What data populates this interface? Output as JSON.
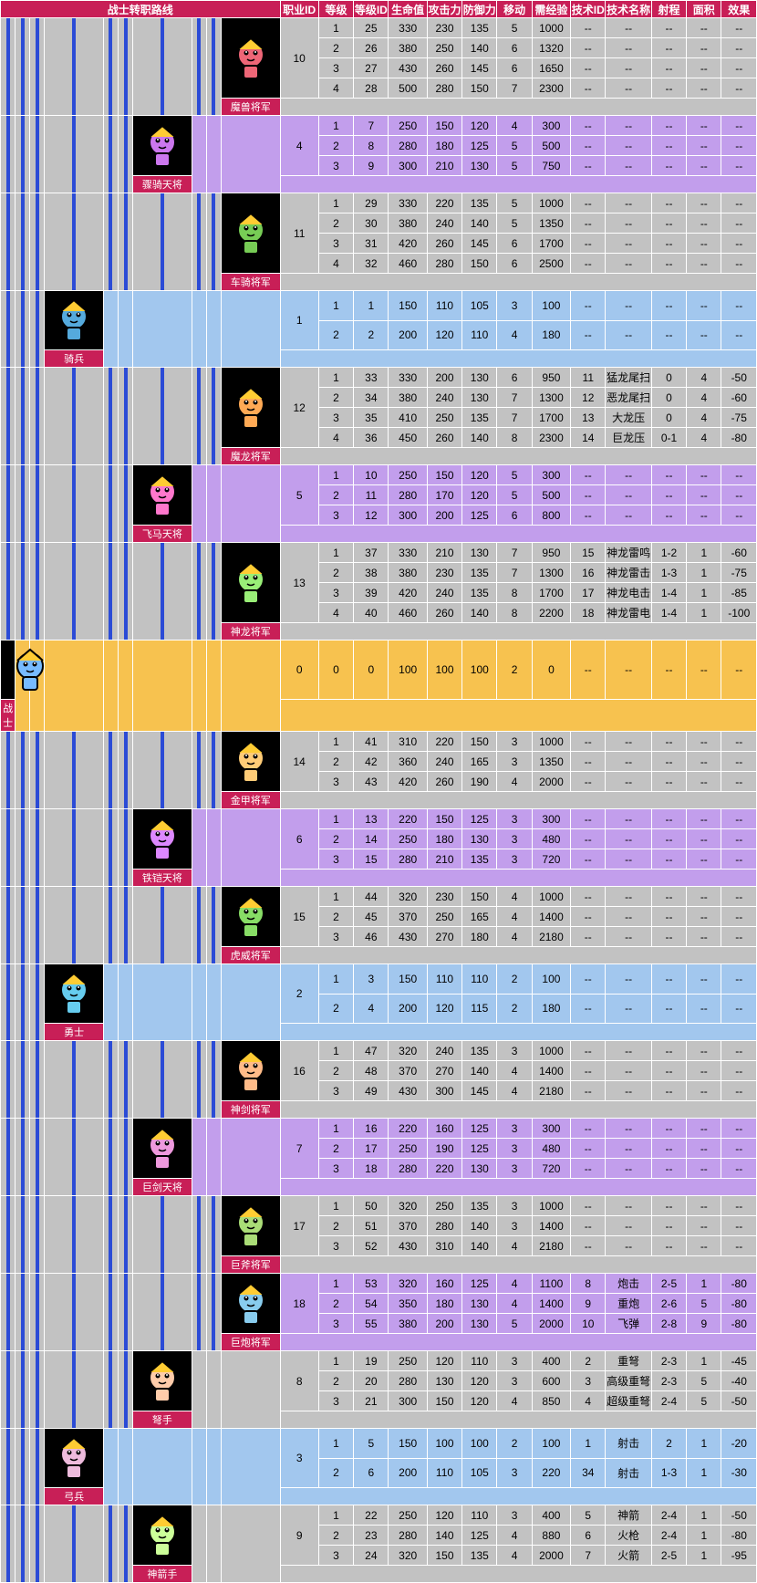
{
  "headers": {
    "tree": "战士转职路线",
    "jobid": "职业ID",
    "lvl": "等级",
    "lvlid": "等级ID",
    "hp": "生命值",
    "atk": "攻击力",
    "def": "防御力",
    "mov": "移动",
    "exp": "需经验",
    "skillid": "技术ID",
    "skillname": "技术名称",
    "range": "射程",
    "area": "面积",
    "effect": "效果"
  },
  "na": "--",
  "chart_data": {
    "type": "table",
    "title": "战士转职路线",
    "root": {
      "name": "战士",
      "jobid": 0,
      "color": "gold",
      "rows": [
        [
          0,
          0,
          100,
          100,
          100,
          2,
          0,
          "--",
          "--",
          "--",
          "--",
          "--"
        ]
      ]
    },
    "tier2": [
      {
        "name": "骑兵",
        "jobid": 1,
        "color": "blue",
        "rows": [
          [
            1,
            1,
            150,
            110,
            105,
            3,
            100,
            "--",
            "--",
            "--",
            "--",
            "--"
          ],
          [
            2,
            2,
            200,
            120,
            110,
            4,
            180,
            "--",
            "--",
            "--",
            "--",
            "--"
          ]
        ]
      },
      {
        "name": "勇士",
        "jobid": 2,
        "color": "blue",
        "rows": [
          [
            1,
            3,
            150,
            110,
            110,
            2,
            100,
            "--",
            "--",
            "--",
            "--",
            "--"
          ],
          [
            2,
            4,
            200,
            120,
            115,
            2,
            180,
            "--",
            "--",
            "--",
            "--",
            "--"
          ]
        ]
      },
      {
        "name": "弓兵",
        "jobid": 3,
        "color": "blue",
        "rows": [
          [
            1,
            5,
            150,
            100,
            100,
            2,
            100,
            1,
            "射击",
            "2",
            1,
            -20
          ],
          [
            2,
            6,
            200,
            110,
            105,
            3,
            220,
            34,
            "射击",
            "1-3",
            1,
            -30
          ]
        ]
      }
    ],
    "tier3": [
      {
        "parent": "骑兵",
        "name": "骤骑天将",
        "jobid": 4,
        "color": "purple",
        "rows": [
          [
            1,
            7,
            250,
            150,
            120,
            4,
            300,
            "--",
            "--",
            "--",
            "--",
            "--"
          ],
          [
            2,
            8,
            280,
            180,
            125,
            5,
            500,
            "--",
            "--",
            "--",
            "--",
            "--"
          ],
          [
            3,
            9,
            300,
            210,
            130,
            5,
            750,
            "--",
            "--",
            "--",
            "--",
            "--"
          ]
        ]
      },
      {
        "parent": "骑兵",
        "name": "飞马天将",
        "jobid": 5,
        "color": "purple",
        "rows": [
          [
            1,
            10,
            250,
            150,
            120,
            5,
            300,
            "--",
            "--",
            "--",
            "--",
            "--"
          ],
          [
            2,
            11,
            280,
            170,
            120,
            5,
            500,
            "--",
            "--",
            "--",
            "--",
            "--"
          ],
          [
            3,
            12,
            300,
            200,
            125,
            6,
            800,
            "--",
            "--",
            "--",
            "--",
            "--"
          ]
        ]
      },
      {
        "parent": "勇士",
        "name": "铁铠天将",
        "jobid": 6,
        "color": "purple",
        "rows": [
          [
            1,
            13,
            220,
            150,
            125,
            3,
            300,
            "--",
            "--",
            "--",
            "--",
            "--"
          ],
          [
            2,
            14,
            250,
            180,
            130,
            3,
            480,
            "--",
            "--",
            "--",
            "--",
            "--"
          ],
          [
            3,
            15,
            280,
            210,
            135,
            3,
            720,
            "--",
            "--",
            "--",
            "--",
            "--"
          ]
        ]
      },
      {
        "parent": "勇士",
        "name": "巨剑天将",
        "jobid": 7,
        "color": "purple",
        "rows": [
          [
            1,
            16,
            220,
            160,
            125,
            3,
            300,
            "--",
            "--",
            "--",
            "--",
            "--"
          ],
          [
            2,
            17,
            250,
            190,
            125,
            3,
            480,
            "--",
            "--",
            "--",
            "--",
            "--"
          ],
          [
            3,
            18,
            280,
            220,
            130,
            3,
            720,
            "--",
            "--",
            "--",
            "--",
            "--"
          ]
        ]
      },
      {
        "parent": "弓兵",
        "name": "弩手",
        "jobid": 8,
        "color": "grey",
        "rows": [
          [
            1,
            19,
            250,
            120,
            110,
            3,
            400,
            2,
            "重弩",
            "2-3",
            1,
            -45
          ],
          [
            2,
            20,
            280,
            130,
            120,
            3,
            600,
            3,
            "高级重弩",
            "2-3",
            5,
            -40
          ],
          [
            3,
            21,
            300,
            150,
            120,
            4,
            850,
            4,
            "超级重弩",
            "2-4",
            5,
            -50
          ]
        ]
      },
      {
        "parent": "弓兵",
        "name": "神箭手",
        "jobid": 9,
        "color": "grey",
        "rows": [
          [
            1,
            22,
            250,
            120,
            110,
            3,
            400,
            5,
            "神箭",
            "2-4",
            1,
            -50
          ],
          [
            2,
            23,
            280,
            140,
            125,
            4,
            880,
            6,
            "火枪",
            "2-4",
            1,
            -80
          ],
          [
            3,
            24,
            320,
            150,
            135,
            4,
            2000,
            7,
            "火箭",
            "2-5",
            1,
            -95
          ]
        ]
      }
    ],
    "tier4": [
      {
        "parent": "骤骑天将",
        "name": "魔兽将军",
        "jobid": 10,
        "color": "grey",
        "rows": [
          [
            1,
            25,
            330,
            230,
            135,
            5,
            1000,
            "--",
            "--",
            "--",
            "--",
            "--"
          ],
          [
            2,
            26,
            380,
            250,
            140,
            6,
            1320,
            "--",
            "--",
            "--",
            "--",
            "--"
          ],
          [
            3,
            27,
            430,
            260,
            145,
            6,
            1650,
            "--",
            "--",
            "--",
            "--",
            "--"
          ],
          [
            4,
            28,
            500,
            280,
            150,
            7,
            2300,
            "--",
            "--",
            "--",
            "--",
            "--"
          ]
        ]
      },
      {
        "parent": "骤骑天将",
        "name": "车骑将军",
        "jobid": 11,
        "color": "grey",
        "rows": [
          [
            1,
            29,
            330,
            220,
            135,
            5,
            1000,
            "--",
            "--",
            "--",
            "--",
            "--"
          ],
          [
            2,
            30,
            380,
            240,
            140,
            5,
            1350,
            "--",
            "--",
            "--",
            "--",
            "--"
          ],
          [
            3,
            31,
            420,
            260,
            145,
            6,
            1700,
            "--",
            "--",
            "--",
            "--",
            "--"
          ],
          [
            4,
            32,
            460,
            280,
            150,
            6,
            2500,
            "--",
            "--",
            "--",
            "--",
            "--"
          ]
        ]
      },
      {
        "parent": "飞马天将",
        "name": "魔龙将军",
        "jobid": 12,
        "color": "grey",
        "rows": [
          [
            1,
            33,
            330,
            200,
            130,
            6,
            950,
            11,
            "猛龙尾扫",
            "0",
            4,
            -50
          ],
          [
            2,
            34,
            380,
            240,
            130,
            7,
            1300,
            12,
            "恶龙尾扫",
            "0",
            4,
            -60
          ],
          [
            3,
            35,
            410,
            250,
            135,
            7,
            1700,
            13,
            "大龙压",
            "0",
            4,
            -75
          ],
          [
            4,
            36,
            450,
            260,
            140,
            8,
            2300,
            14,
            "巨龙压",
            "0-1",
            4,
            -80
          ]
        ]
      },
      {
        "parent": "飞马天将",
        "name": "神龙将军",
        "jobid": 13,
        "color": "grey",
        "rows": [
          [
            1,
            37,
            330,
            210,
            130,
            7,
            950,
            15,
            "神龙雷鸣",
            "1-2",
            1,
            -60
          ],
          [
            2,
            38,
            380,
            230,
            135,
            7,
            1300,
            16,
            "神龙雷击",
            "1-3",
            1,
            -75
          ],
          [
            3,
            39,
            420,
            240,
            135,
            8,
            1700,
            17,
            "神龙电击",
            "1-4",
            1,
            -85
          ],
          [
            4,
            40,
            460,
            260,
            140,
            8,
            2200,
            18,
            "神龙雷电",
            "1-4",
            1,
            -100
          ]
        ]
      },
      {
        "parent": "铁铠天将",
        "name": "金甲将军",
        "jobid": 14,
        "color": "grey",
        "rows": [
          [
            1,
            41,
            310,
            220,
            150,
            3,
            1000,
            "--",
            "--",
            "--",
            "--",
            "--"
          ],
          [
            2,
            42,
            360,
            240,
            165,
            3,
            1350,
            "--",
            "--",
            "--",
            "--",
            "--"
          ],
          [
            3,
            43,
            420,
            260,
            190,
            4,
            2000,
            "--",
            "--",
            "--",
            "--",
            "--"
          ]
        ]
      },
      {
        "parent": "铁铠天将",
        "name": "虎威将军",
        "jobid": 15,
        "color": "grey",
        "rows": [
          [
            1,
            44,
            320,
            230,
            150,
            4,
            1000,
            "--",
            "--",
            "--",
            "--",
            "--"
          ],
          [
            2,
            45,
            370,
            250,
            165,
            4,
            1400,
            "--",
            "--",
            "--",
            "--",
            "--"
          ],
          [
            3,
            46,
            430,
            270,
            180,
            4,
            2180,
            "--",
            "--",
            "--",
            "--",
            "--"
          ]
        ]
      },
      {
        "parent": "巨剑天将",
        "name": "神剑将军",
        "jobid": 16,
        "color": "grey",
        "rows": [
          [
            1,
            47,
            320,
            240,
            135,
            3,
            1000,
            "--",
            "--",
            "--",
            "--",
            "--"
          ],
          [
            2,
            48,
            370,
            270,
            140,
            4,
            1400,
            "--",
            "--",
            "--",
            "--",
            "--"
          ],
          [
            3,
            49,
            430,
            300,
            145,
            4,
            2180,
            "--",
            "--",
            "--",
            "--",
            "--"
          ]
        ]
      },
      {
        "parent": "巨剑天将",
        "name": "巨斧将军",
        "jobid": 17,
        "color": "grey",
        "rows": [
          [
            1,
            50,
            320,
            250,
            135,
            3,
            1000,
            "--",
            "--",
            "--",
            "--",
            "--"
          ],
          [
            2,
            51,
            370,
            280,
            140,
            3,
            1400,
            "--",
            "--",
            "--",
            "--",
            "--"
          ],
          [
            3,
            52,
            430,
            310,
            140,
            4,
            2180,
            "--",
            "--",
            "--",
            "--",
            "--"
          ]
        ]
      },
      {
        "parent": "巨剑天将",
        "name": "巨炮将军",
        "jobid": 18,
        "color": "purple",
        "rows": [
          [
            1,
            53,
            320,
            160,
            125,
            4,
            1100,
            8,
            "炮击",
            "2-5",
            1,
            -80
          ],
          [
            2,
            54,
            350,
            180,
            130,
            4,
            1400,
            9,
            "重炮",
            "2-6",
            5,
            -80
          ],
          [
            3,
            55,
            380,
            200,
            130,
            5,
            2000,
            10,
            "飞弹",
            "2-8",
            9,
            -80
          ]
        ]
      }
    ]
  }
}
